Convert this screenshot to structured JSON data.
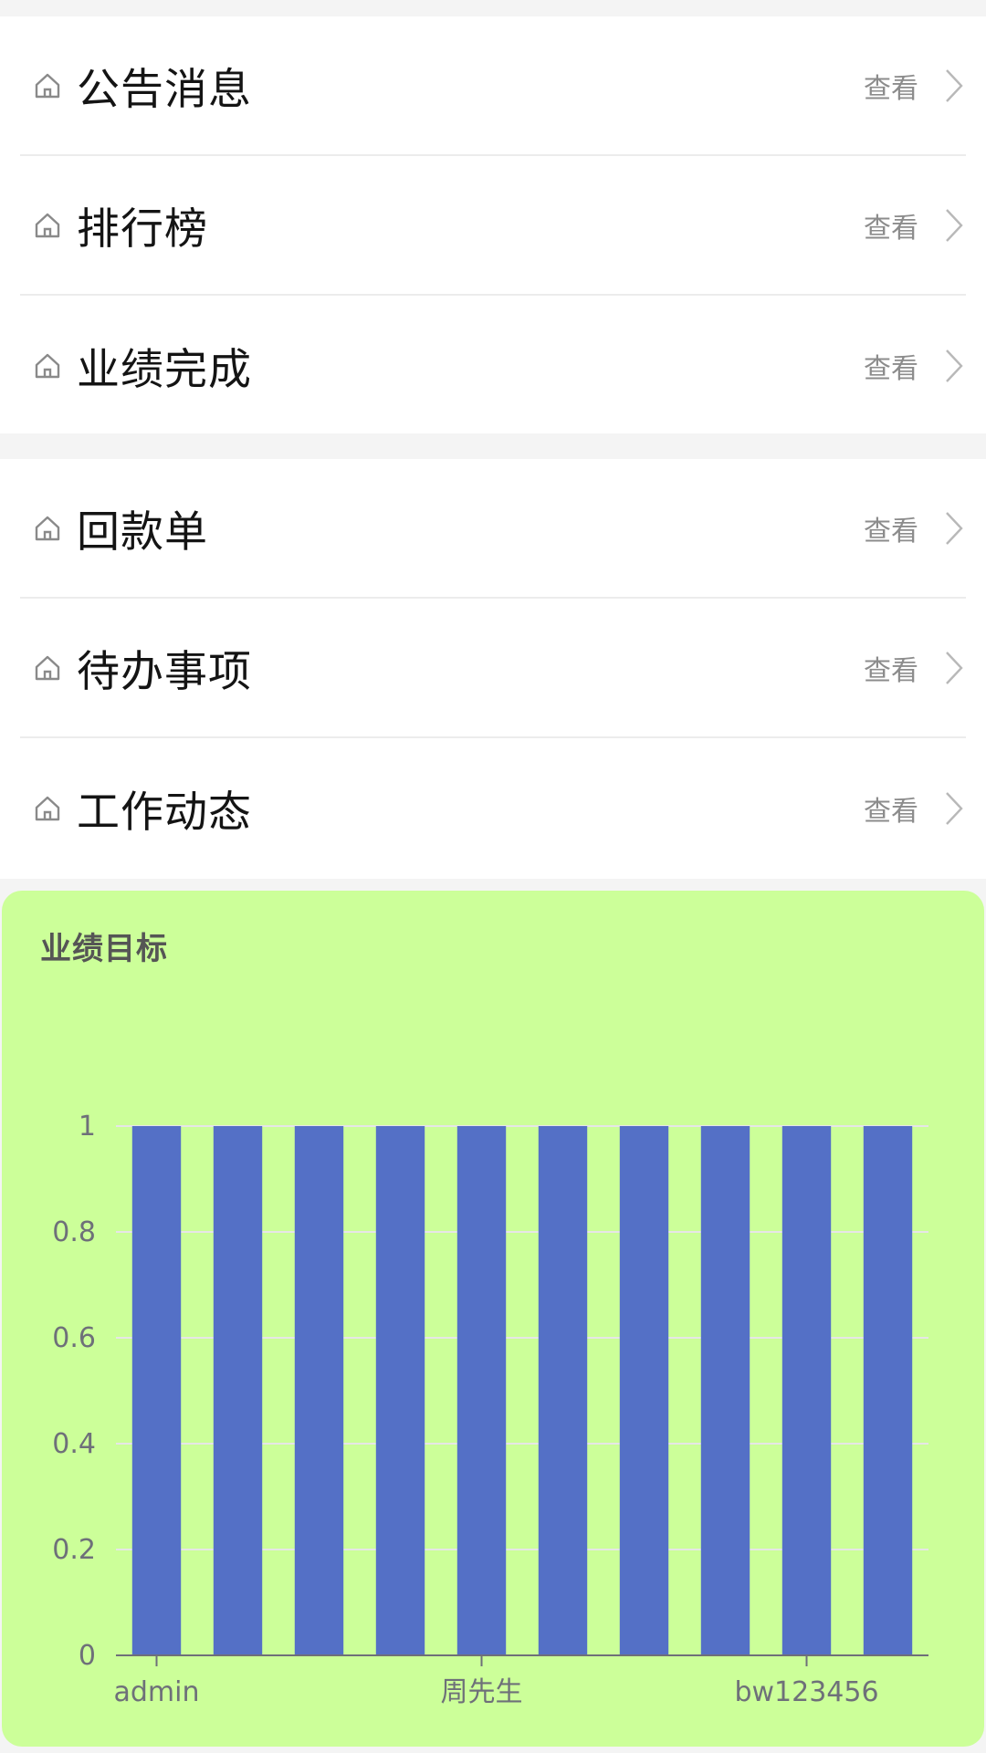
{
  "menu_group_1": [
    {
      "label": "公告消息",
      "action": "查看",
      "icon": "home-icon"
    },
    {
      "label": "排行榜",
      "action": "查看",
      "icon": "home-icon"
    },
    {
      "label": "业绩完成",
      "action": "查看",
      "icon": "home-icon"
    }
  ],
  "menu_group_2": [
    {
      "label": "回款单",
      "action": "查看",
      "icon": "home-icon"
    },
    {
      "label": "待办事项",
      "action": "查看",
      "icon": "home-icon"
    },
    {
      "label": "工作动态",
      "action": "查看",
      "icon": "home-icon"
    }
  ],
  "card": {
    "title": "业绩目标",
    "background": "#ccff99"
  },
  "chart_data": {
    "type": "bar",
    "title": "业绩目标",
    "categories": [
      "admin",
      "",
      "",
      "",
      "周先生",
      "",
      "",
      "",
      "bw123456",
      ""
    ],
    "x_tick_labels": [
      "admin",
      "周先生",
      "bw123456"
    ],
    "values": [
      1,
      1,
      1,
      1,
      1,
      1,
      1,
      1,
      1,
      1
    ],
    "ylim": [
      0,
      1
    ],
    "yticks": [
      "0",
      "0.2",
      "0.4",
      "0.6",
      "0.8",
      "1"
    ],
    "bar_color": "#5470c6",
    "grid": true,
    "xlabel": "",
    "ylabel": ""
  }
}
